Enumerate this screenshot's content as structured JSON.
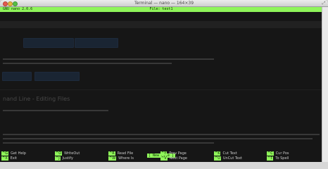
{
  "window": {
    "title": "Terminal — nano — 164×39"
  },
  "nano": {
    "version": "GNU nano 2.0.6",
    "file": "File: test1",
    "status_message": "[ New File ]"
  },
  "ghost_page": {
    "title": "nand Line - Editing Files"
  },
  "shortcuts": [
    {
      "key": "^G",
      "label": "Get Help"
    },
    {
      "key": "^O",
      "label": "WriteOut"
    },
    {
      "key": "^R",
      "label": "Read File"
    },
    {
      "key": "^Y",
      "label": "Prev Page"
    },
    {
      "key": "^K",
      "label": "Cut Text"
    },
    {
      "key": "^C",
      "label": "Cur Pos"
    },
    {
      "key": "^X",
      "label": "Exit"
    },
    {
      "key": "^J",
      "label": "Justify"
    },
    {
      "key": "^W",
      "label": "Where Is"
    },
    {
      "key": "^V",
      "label": "Next Page"
    },
    {
      "key": "^U",
      "label": "UnCut Text"
    },
    {
      "key": "^T",
      "label": "To Spell"
    }
  ],
  "colors": {
    "nano_green": "#8ff55a",
    "terminal_bg": "#161616"
  }
}
